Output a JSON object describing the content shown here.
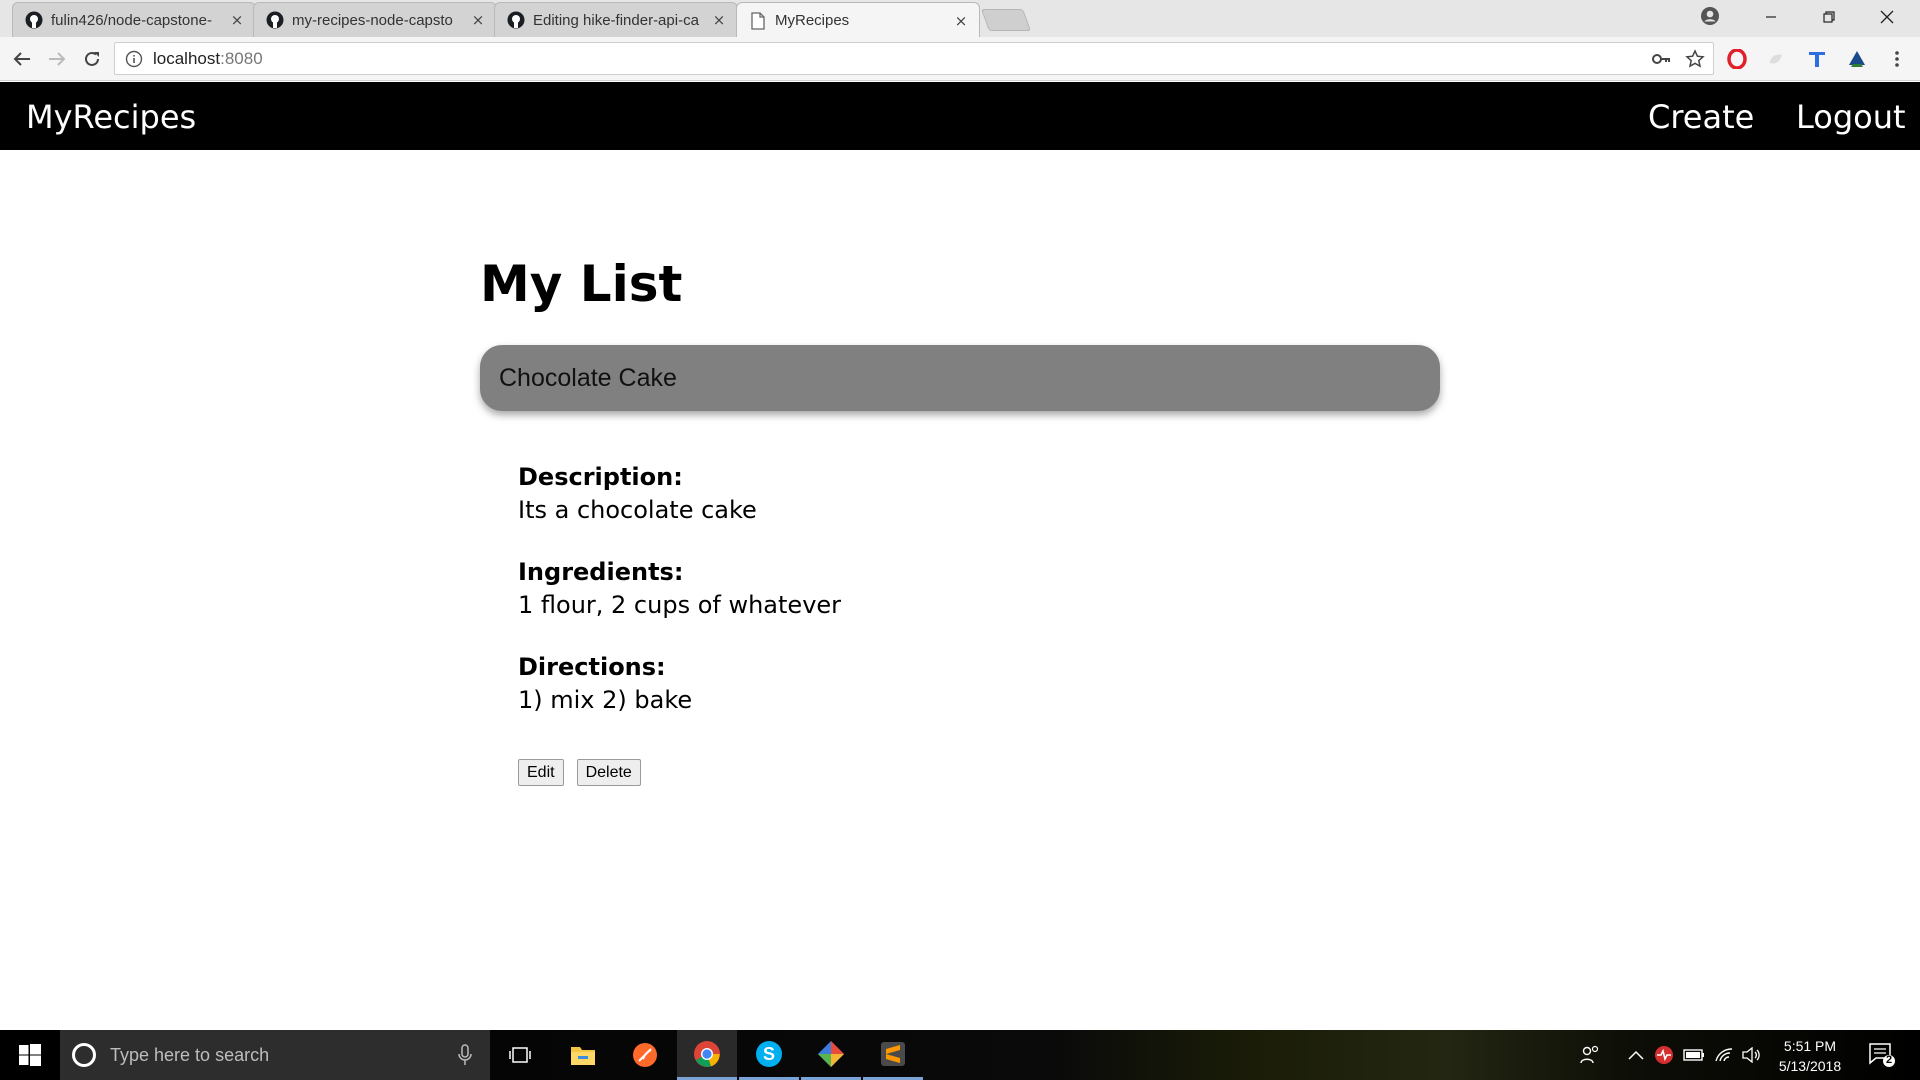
{
  "browser": {
    "tabs": [
      {
        "title": "fulin426/node-capstone-",
        "icon": "github-icon",
        "active": false
      },
      {
        "title": "my-recipes-node-capsto",
        "icon": "github-icon",
        "active": false
      },
      {
        "title": "Editing hike-finder-api-ca",
        "icon": "github-icon",
        "active": false
      },
      {
        "title": "MyRecipes",
        "icon": "page-icon",
        "active": true
      }
    ],
    "close_glyph": "×",
    "address": {
      "host": "localhost",
      "port": ":8080"
    }
  },
  "app": {
    "brand": "MyRecipes",
    "nav": {
      "create": "Create",
      "logout": "Logout"
    }
  },
  "page": {
    "heading": "My List",
    "recipe": {
      "title": "Chocolate Cake",
      "description_label": "Description:",
      "description": "Its a chocolate cake",
      "ingredients_label": "Ingredients:",
      "ingredients": "1 flour, 2 cups of whatever",
      "directions_label": "Directions:",
      "directions": "1) mix 2) bake"
    },
    "buttons": {
      "edit": "Edit",
      "delete": "Delete"
    }
  },
  "taskbar": {
    "search_placeholder": "Type here to search",
    "time": "5:51 PM",
    "date": "5/13/2018",
    "notification_count": "2"
  },
  "colors": {
    "appbar": "#000000",
    "recipe_bar": "#808080",
    "taskbar_accent": "#7aa3d6"
  }
}
